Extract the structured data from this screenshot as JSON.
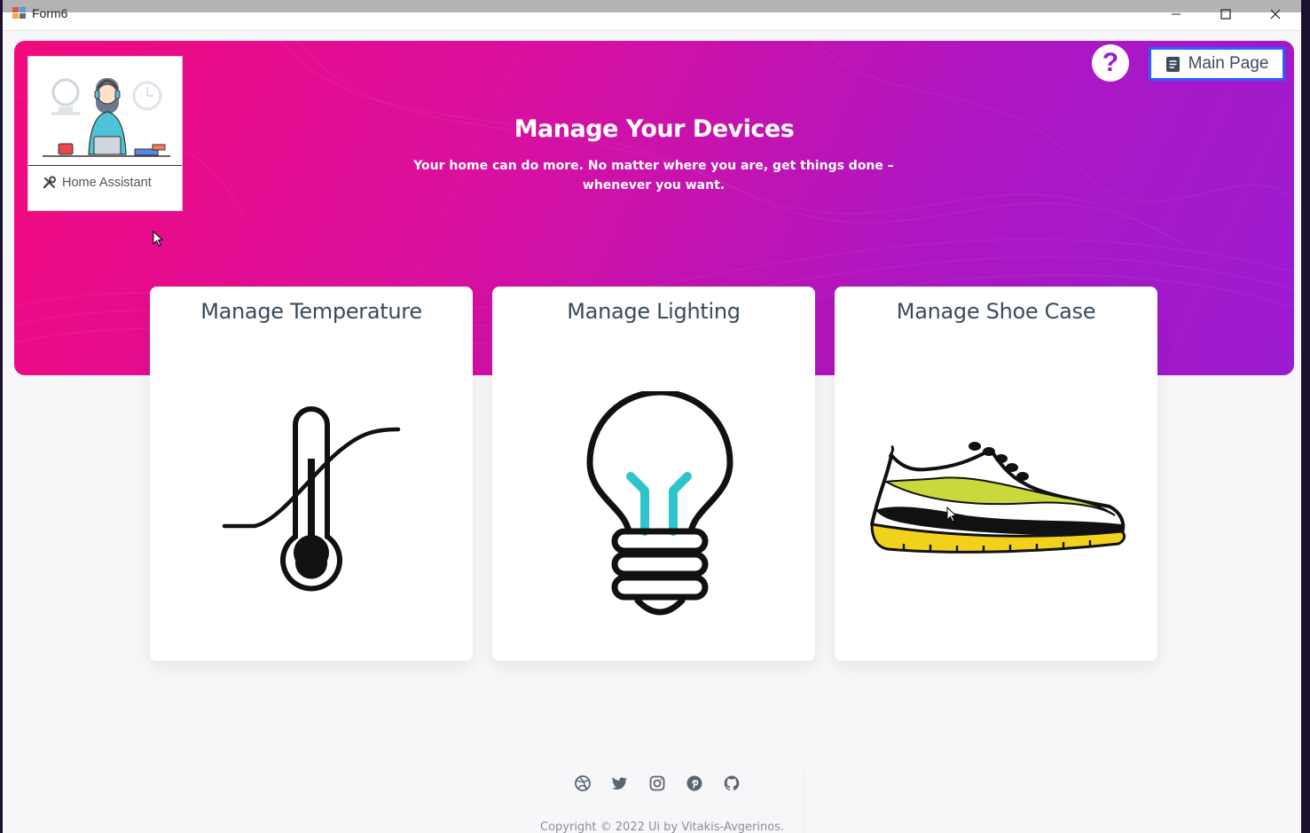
{
  "window": {
    "title": "Form6"
  },
  "logo": {
    "label": "Home Assistant"
  },
  "hero": {
    "title": "Manage Your Devices",
    "subtitle": "Your home can do more. No matter where you are, get things done – whenever you want.",
    "gradient_start": "#f2097d",
    "gradient_end": "#9b1bd0"
  },
  "header": {
    "help_label": "?",
    "main_page_label": "Main Page",
    "button_border": "#2962ff"
  },
  "cards": [
    {
      "title": "Manage Temperature",
      "icon": "thermometer-icon"
    },
    {
      "title": "Manage Lighting",
      "icon": "lightbulb-icon"
    },
    {
      "title": "Manage Shoe Case",
      "icon": "sneaker-icon"
    }
  ],
  "footer": {
    "social": [
      "dribbble-icon",
      "twitter-icon",
      "instagram-icon",
      "pinterest-icon",
      "github-icon"
    ],
    "copyright": "Copyright © 2022 Ui by Vitakis-Avgerinos."
  }
}
